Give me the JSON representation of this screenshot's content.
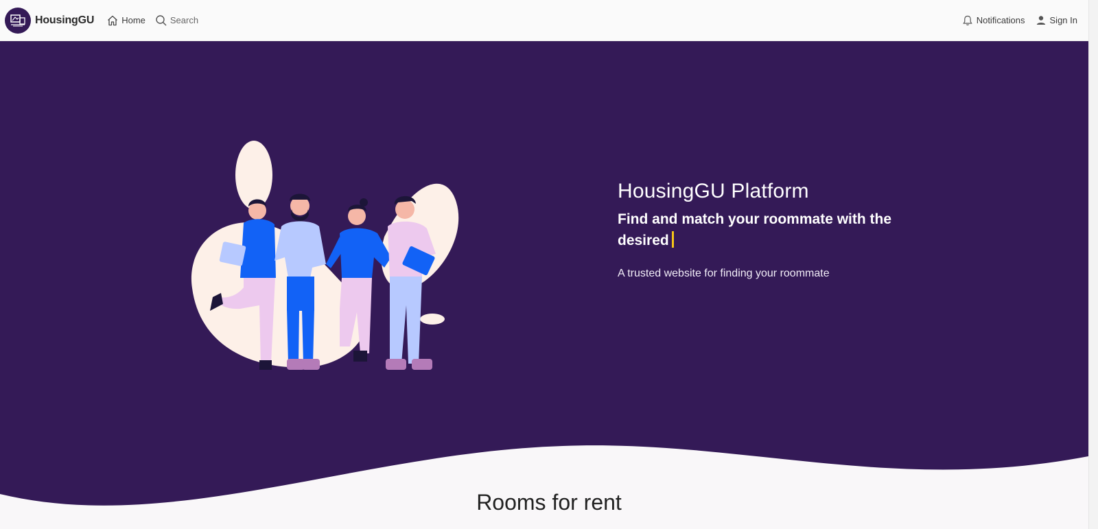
{
  "navbar": {
    "brand": "HousingGU",
    "links": {
      "home": "Home",
      "search": "Search",
      "notifications": "Notifications",
      "sign_in": "Sign In"
    },
    "icons": {
      "logo": "housing-logo-icon",
      "home": "home-icon",
      "search": "search-icon",
      "notifications": "bell-icon",
      "sign_in": "user-icon"
    }
  },
  "hero": {
    "title": "HousingGU Platform",
    "subtitle": "Find and match your roommate with the desired",
    "description": "A trusted website for finding your roommate",
    "illustration": "group-of-four-roommates-illustration",
    "colors": {
      "background": "#341a57",
      "blob": "#fdf0e8",
      "primary_blue": "#1262f6",
      "caret": "#f5c518"
    }
  },
  "sections": {
    "rooms_title": "Rooms for rent"
  }
}
